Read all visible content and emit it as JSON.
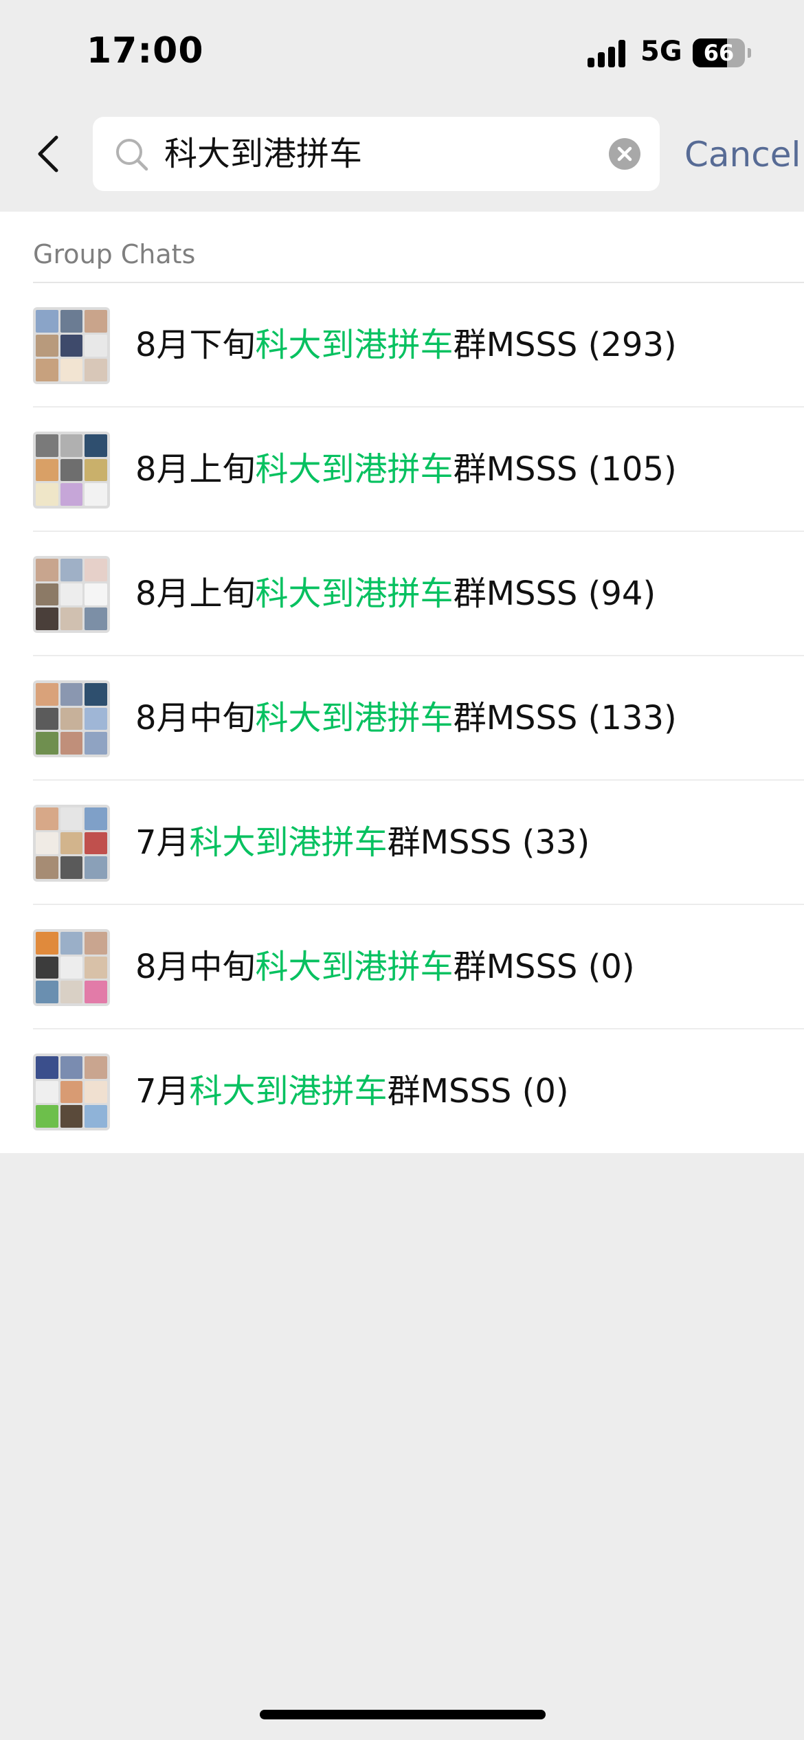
{
  "status_bar": {
    "time": "17:00",
    "network": "5G",
    "battery_percent": "66",
    "battery_level": 0.66
  },
  "search": {
    "back_icon": "chevron-left-icon",
    "search_icon": "magnifier-icon",
    "query": "科大到港拼车",
    "clear_icon": "clear-circle-icon",
    "cancel_label": "Cancel"
  },
  "results": {
    "section_title": "Group Chats",
    "highlight_color": "#07C160",
    "items": [
      {
        "prefix": "8月下旬",
        "match": "科大到港拼车",
        "suffix": "群MSSS (293)"
      },
      {
        "prefix": "8月上旬",
        "match": "科大到港拼车",
        "suffix": "群MSSS (105)"
      },
      {
        "prefix": "8月上旬",
        "match": "科大到港拼车",
        "suffix": "群MSSS (94)"
      },
      {
        "prefix": "8月中旬",
        "match": "科大到港拼车",
        "suffix": "群MSSS (133)"
      },
      {
        "prefix": "7月",
        "match": "科大到港拼车",
        "suffix": "群MSSS (33)"
      },
      {
        "prefix": "8月中旬",
        "match": "科大到港拼车",
        "suffix": "群MSSS (0)"
      },
      {
        "prefix": "7月",
        "match": "科大到港拼车",
        "suffix": "群MSSS (0)"
      }
    ]
  },
  "colors": {
    "page_background": "#EDEDED",
    "panel_background": "#FFFFFF",
    "cancel_link": "#576B95",
    "section_header_text": "#7F7F7F"
  }
}
